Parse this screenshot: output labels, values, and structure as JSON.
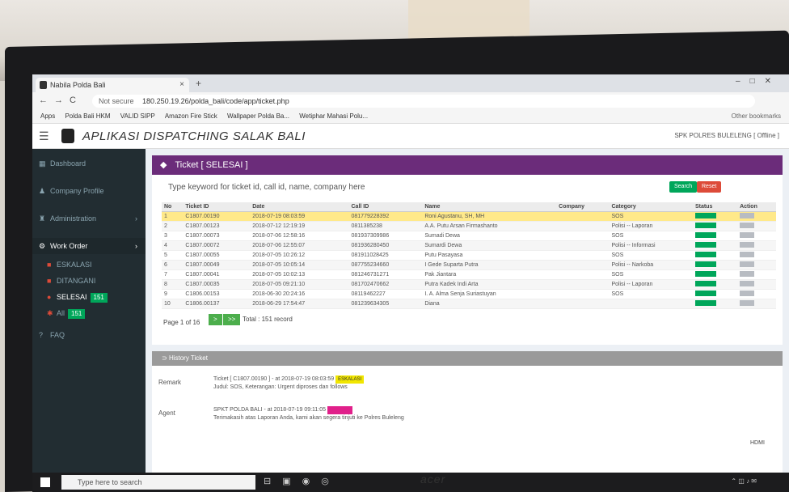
{
  "browser": {
    "tab_title": "Nabila Polda Bali",
    "close_tab": "×",
    "new_tab": "+",
    "url_security": "Not secure",
    "url": "180.250.19.26/polda_bali/code/app/ticket.php",
    "bookmarks": [
      "Apps",
      "Polda Bali HKM",
      "VALID SIPP",
      "Amazon Fire Stick",
      "Wallpaper Polda Ba...",
      "Wetiphar Mahasi Polu..."
    ],
    "other_bookmarks": "Other bookmarks"
  },
  "app": {
    "title": "APLIKASI DISPATCHING SALAK BALI",
    "user": "SPK POLRES BULELENG [ Offline ]"
  },
  "sidebar": {
    "items": [
      {
        "label": "Dashboard"
      },
      {
        "label": "Company Profile"
      },
      {
        "label": "Administration"
      },
      {
        "label": "Work Order"
      }
    ],
    "sub_items": [
      {
        "label": "ESKALASI",
        "badge": ""
      },
      {
        "label": "DITANGANI",
        "badge": ""
      },
      {
        "label": "SELESAI",
        "badge": "151"
      },
      {
        "label": "All",
        "badge": "151"
      }
    ],
    "faq": "FAQ"
  },
  "ticket": {
    "header": "Ticket [ SELESAI ]",
    "search_placeholder": "Type keyword for ticket id, call id, name, company here",
    "search_button": "Search",
    "reset_button": "Reset",
    "columns": [
      "No",
      "Ticket ID",
      "Date",
      "Call ID",
      "Name",
      "Company",
      "Category",
      "Status",
      "Action"
    ],
    "rows": [
      {
        "no": "1",
        "ticket_id": "C1807.00190",
        "date": "2018-07-19 08:03:59",
        "call_id": "081779228392",
        "name": "Roni Agustanu, SH, MH",
        "company": "",
        "category": "SOS"
      },
      {
        "no": "2",
        "ticket_id": "C1807.00123",
        "date": "2018-07-12 12:19:19",
        "call_id": "0811385238",
        "name": "A.A. Putu Arsan Firmashanto",
        "company": "",
        "category": "Polisi -- Laporan"
      },
      {
        "no": "3",
        "ticket_id": "C1807.00073",
        "date": "2018-07-06 12:58:16",
        "call_id": "081937309986",
        "name": "Sumadi Dewa",
        "company": "",
        "category": "SOS"
      },
      {
        "no": "4",
        "ticket_id": "C1807.00072",
        "date": "2018-07-06 12:55:07",
        "call_id": "081936280450",
        "name": "Sumardi Dewa",
        "company": "",
        "category": "Polisi -- Informasi"
      },
      {
        "no": "5",
        "ticket_id": "C1807.00055",
        "date": "2018-07-05 10:26:12",
        "call_id": "081911028425",
        "name": "Putu Pasayasa",
        "company": "",
        "category": "SOS"
      },
      {
        "no": "6",
        "ticket_id": "C1807.00049",
        "date": "2018-07-05 10:05:14",
        "call_id": "087755234660",
        "name": "I Gede Suparta Putra",
        "company": "",
        "category": "Polisi -- Narkoba"
      },
      {
        "no": "7",
        "ticket_id": "C1807.00041",
        "date": "2018-07-05 10:02:13",
        "call_id": "081246731271",
        "name": "Pak Jiantara",
        "company": "",
        "category": "SOS"
      },
      {
        "no": "8",
        "ticket_id": "C1807.00035",
        "date": "2018-07-05 09:21:10",
        "call_id": "081702470662",
        "name": "Putra Kadek Indi Arta",
        "company": "",
        "category": "Polisi -- Laporan"
      },
      {
        "no": "9",
        "ticket_id": "C1806.00153",
        "date": "2018-06-30 20:24:16",
        "call_id": "08119462227",
        "name": "I. A. Alma Senja Suriastuyan",
        "company": "",
        "category": "SOS"
      },
      {
        "no": "10",
        "ticket_id": "C1806.00137",
        "date": "2018-06-29 17:54:47",
        "call_id": "081239634305",
        "name": "Diana",
        "company": "",
        "category": ""
      }
    ],
    "page_label": "Page 1 of 16",
    "next": ">",
    "last": ">>",
    "total": "Total : 151 record"
  },
  "history": {
    "title": "History Ticket",
    "remark_label": "Remark",
    "remark_line1": "Ticket [ C1807.00190 ] - at 2018-07-19 08:03:59",
    "remark_tag": "ESKALASI",
    "remark_line2": "Judul: SOS, Keterangan: Urgent diproses dan follows",
    "agent_label": "Agent",
    "agent_line1": "SPKT POLDA BALI - at 2018-07-19 09:11:05",
    "agent_tag": "SELESAI",
    "agent_line2": "Terimakasih atas Laporan Anda, kami akan segera tinjuti ke Polres Buleleng"
  },
  "taskbar": {
    "search": "Type here to search",
    "monitor_brand": "acer",
    "hdmi": "HDMI"
  },
  "colors": {
    "accent_purple": "#6b2c7a",
    "success": "#00a65a",
    "danger": "#dd4b39",
    "highlight": "#ffe98a"
  }
}
